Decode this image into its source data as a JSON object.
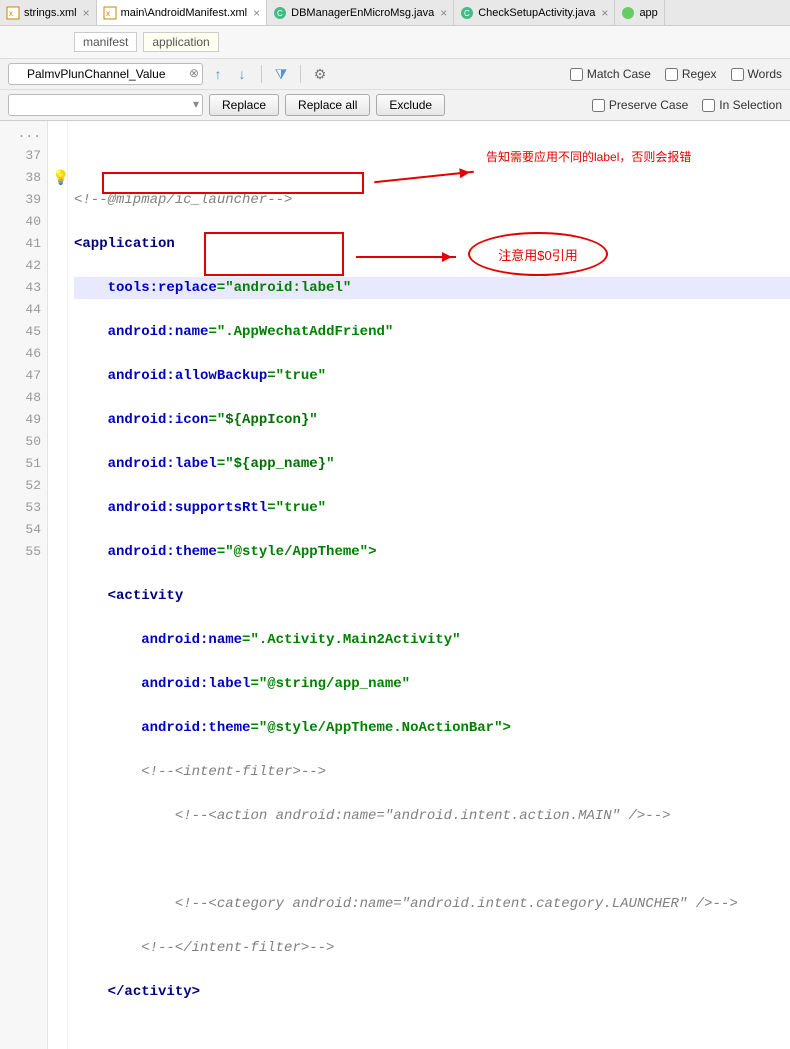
{
  "tabs": [
    {
      "label": "strings.xml",
      "active": false,
      "icon": "xml"
    },
    {
      "label": "main\\AndroidManifest.xml",
      "active": true,
      "icon": "xml"
    },
    {
      "label": "DBManagerEnMicroMsg.java",
      "active": false,
      "icon": "java"
    },
    {
      "label": "CheckSetupActivity.java",
      "active": false,
      "icon": "java"
    },
    {
      "label": "app",
      "active": false,
      "icon": "gradle"
    }
  ],
  "breadcrumbs": [
    {
      "label": "manifest",
      "active": false
    },
    {
      "label": "application",
      "active": true
    }
  ],
  "search": {
    "value": "PalmvPlunChannel_Value",
    "replace_placeholder": ""
  },
  "buttons": {
    "replace": "Replace",
    "replace_all": "Replace all",
    "exclude": "Exclude"
  },
  "options": {
    "match_case": "Match Case",
    "regex": "Regex",
    "words": "Words",
    "preserve_case": "Preserve Case",
    "in_selection": "In Selection"
  },
  "gutter_lines": [
    "...",
    "37",
    "38",
    "39",
    "40",
    "41",
    "42",
    "43",
    "44",
    "45",
    "46",
    "47",
    "48",
    "49",
    "50",
    "51",
    "52",
    "53",
    "54",
    "55"
  ],
  "code": {
    "l37": "<!--@mipmap/ic_launcher-->",
    "l38_open": "<",
    "l38_tag": "application",
    "l39_attr": "tools:replace",
    "l39_eq": "=\"",
    "l39_val": "android:label",
    "l39_end": "\"",
    "l40_attr": "android:name",
    "l40_eq": "=\"",
    "l40_val": ".AppWechatAddFriend",
    "l40_end": "\"",
    "l41_attr": "android:allowBackup",
    "l41_eq": "=\"",
    "l41_val": "true",
    "l41_end": "\"",
    "l42_attr": "android:icon",
    "l42_eq": "=\"",
    "l42_val": "${AppIcon}",
    "l42_end": "\"",
    "l43_attr": "android:label",
    "l43_eq": "=\"",
    "l43_val": "${app_name}",
    "l43_end": "\"",
    "l44_attr": "android:supportsRtl",
    "l44_eq": "=\"",
    "l44_val": "true",
    "l44_end": "\"",
    "l45_attr": "android:theme",
    "l45_eq": "=\"",
    "l45_val": "@style/AppTheme",
    "l45_end": "\">",
    "l46_open": "<",
    "l46_tag": "activity",
    "l47_attr": "android:name",
    "l47_eq": "=\"",
    "l47_val": ".Activity.Main2Activity",
    "l47_end": "\"",
    "l48_attr": "android:label",
    "l48_eq": "=\"",
    "l48_val": "@string/app_name",
    "l48_end": "\"",
    "l49_attr": "android:theme",
    "l49_eq": "=\"",
    "l49_val": "@style/AppTheme.NoActionBar",
    "l49_end": "\">",
    "l50": "<!--<intent-filter>-->",
    "l51": "<!--<action android:name=\"android.intent.action.MAIN\" />-->",
    "l52": "",
    "l53": "<!--<category android:name=\"android.intent.category.LAUNCHER\" />-->",
    "l54": "<!--</intent-filter>-->",
    "l55_open": "</",
    "l55_tag": "activity",
    "l55_end": ">"
  },
  "annotations": {
    "top_text": "告知需要应用不同的label，否则会报错",
    "ellipse_text": "注意用$0引用"
  }
}
